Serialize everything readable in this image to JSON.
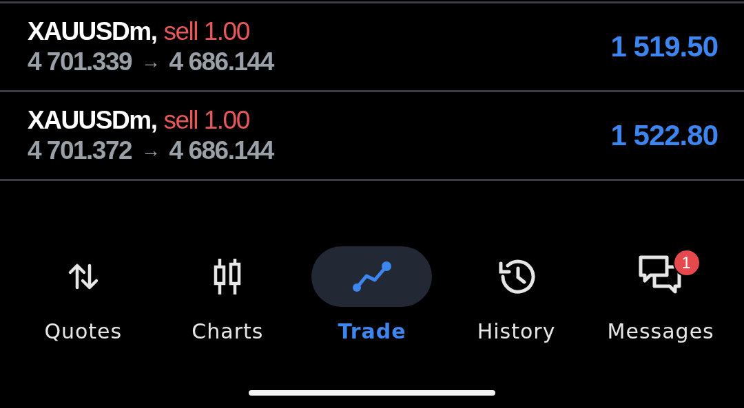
{
  "positions": [
    {
      "symbol": "XAUUSDm,",
      "kind": "sell",
      "volume": "sell 1.00",
      "open_price": "4 701.339",
      "arrow": "→",
      "current_price": "4 686.144",
      "profit": "1 519.50"
    },
    {
      "symbol": "XAUUSDm,",
      "kind": "sell",
      "volume": "sell 1.00",
      "open_price": "4 701.372",
      "arrow": "→",
      "current_price": "4 686.144",
      "profit": "1 522.80"
    }
  ],
  "nav": [
    {
      "label": "Quotes",
      "kind": "quotes",
      "selected": false
    },
    {
      "label": "Charts",
      "kind": "charts",
      "selected": false
    },
    {
      "label": "Trade",
      "kind": "trade",
      "selected": true
    },
    {
      "label": "History",
      "kind": "history",
      "selected": false
    },
    {
      "label": "Messages",
      "kind": "messages",
      "selected": false,
      "badge": "1"
    }
  ]
}
